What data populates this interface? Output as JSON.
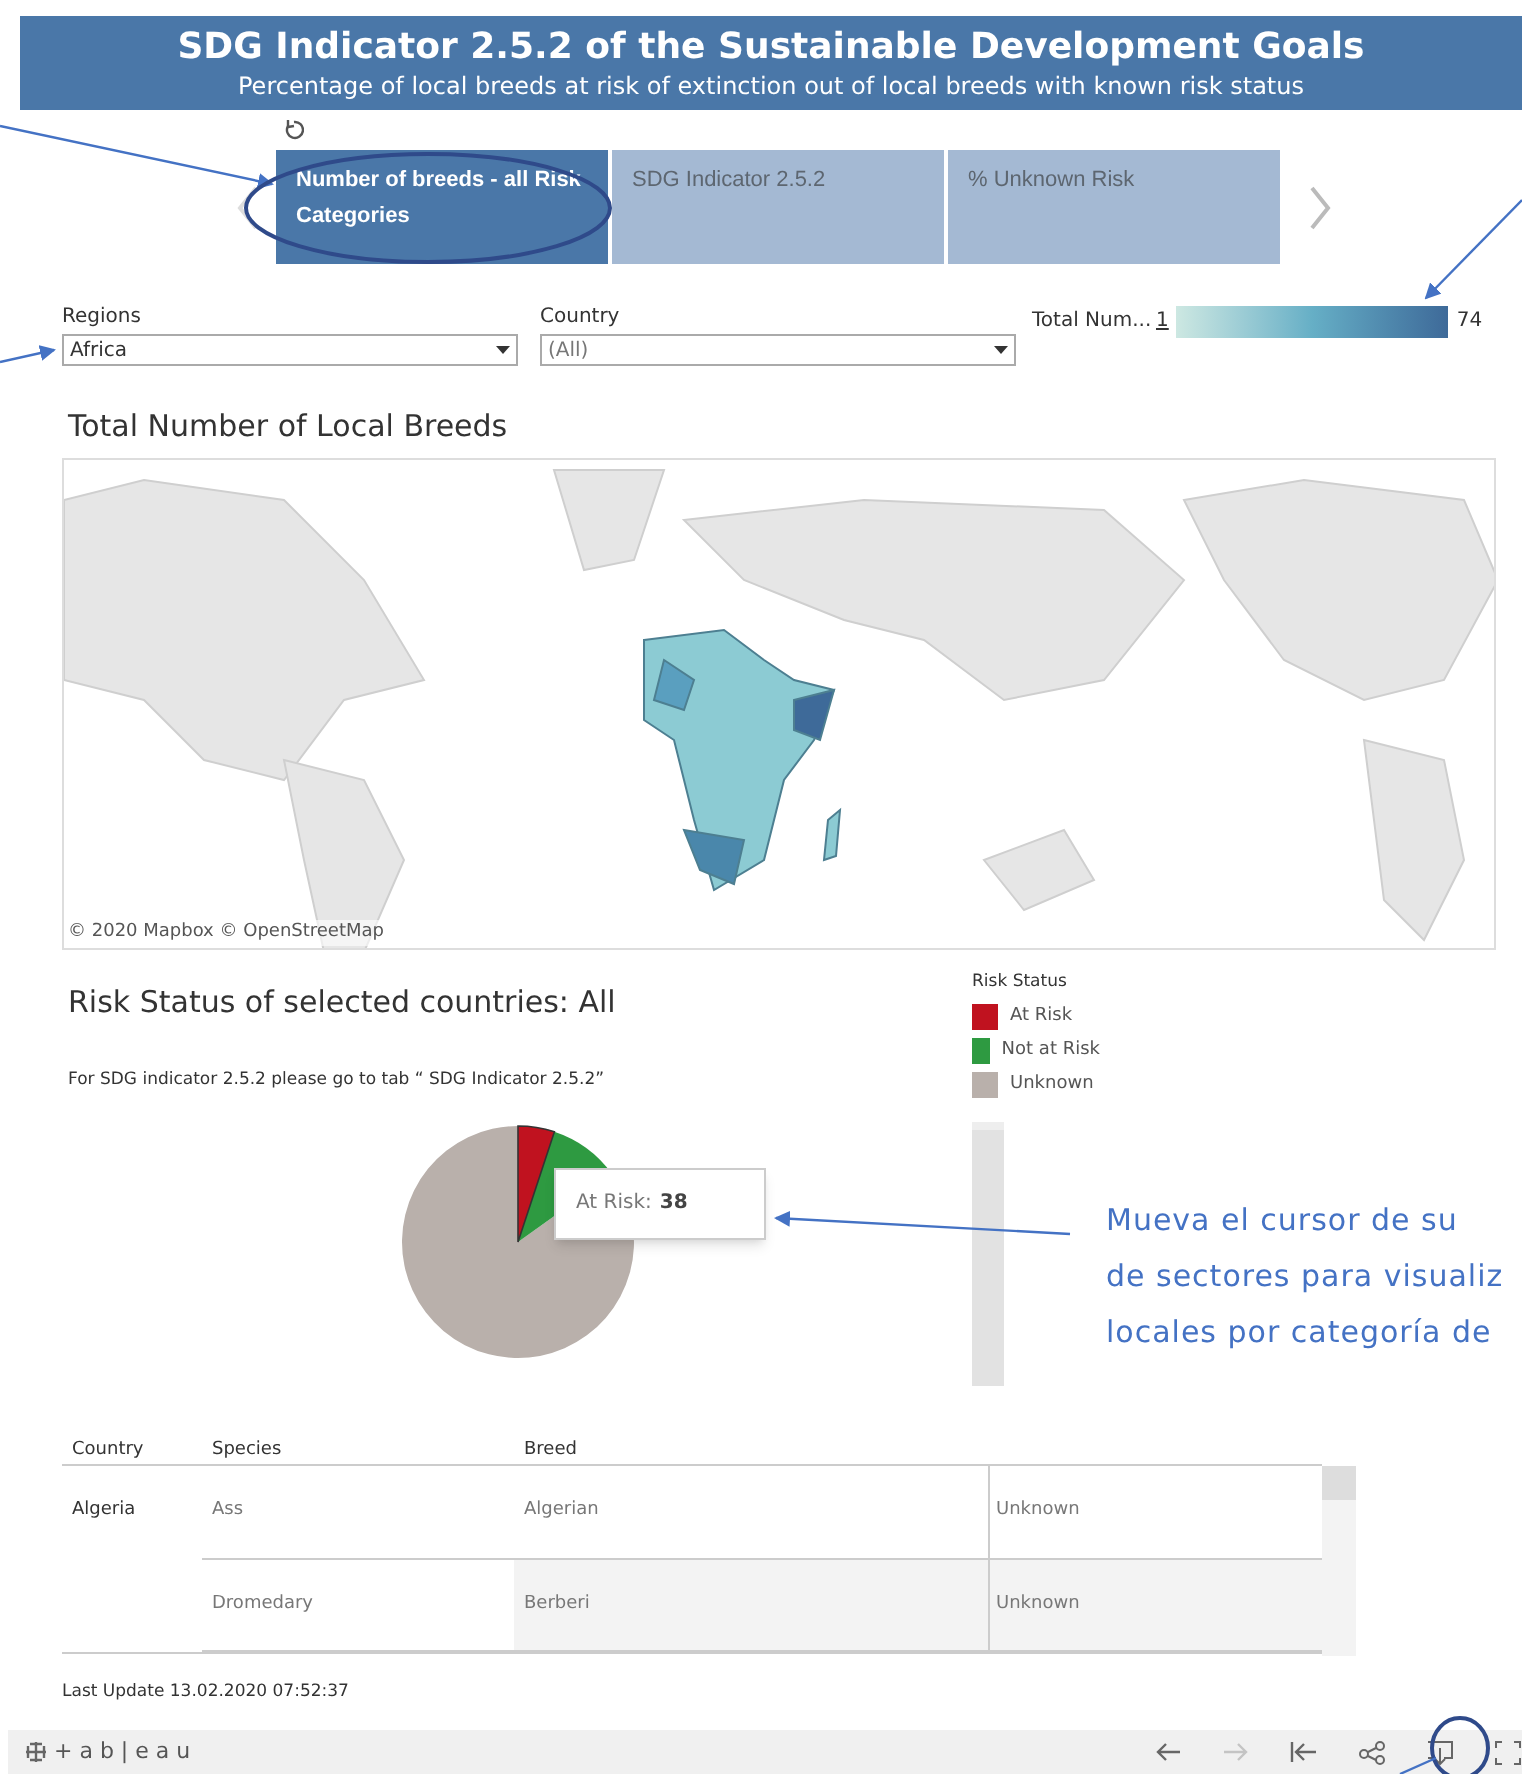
{
  "header": {
    "title": "SDG Indicator 2.5.2 of the Sustainable Development Goals",
    "subtitle": "Percentage of local breeds at risk of extinction out of local breeds with known risk status"
  },
  "tabs": [
    {
      "label": "Number of breeds - all Risk Categories",
      "selected": true
    },
    {
      "label": "SDG Indicator 2.5.2",
      "selected": false
    },
    {
      "label": "% Unknown Risk",
      "selected": false
    }
  ],
  "filters": [
    {
      "label": "Regions",
      "value": "Africa"
    },
    {
      "label": "Country",
      "value": "(All)"
    }
  ],
  "color_legend": {
    "label": "Total Num...",
    "min": "1",
    "max": "74"
  },
  "map": {
    "title": "Total Number of Local Breeds",
    "attribution": "© 2020 Mapbox © OpenStreetMap"
  },
  "risk": {
    "title": "Risk Status of selected countries: All",
    "note": "For SDG indicator 2.5.2 please go to tab  “ SDG Indicator 2.5.2”",
    "legend_title": "Risk Status",
    "legend": [
      {
        "label": "At Risk",
        "color": "#c0121f"
      },
      {
        "label": "Not at Risk",
        "color": "#2e9a41"
      },
      {
        "label": "Unknown",
        "color": "#b9b0ab"
      }
    ],
    "tooltip": {
      "label": "At Risk:",
      "value": "38"
    }
  },
  "callout_lines": [
    "Mueva el cursor de su",
    "de sectores para visualiz",
    "locales por categoría de"
  ],
  "table": {
    "columns": [
      "Country",
      "Species",
      "Breed"
    ],
    "rows": [
      {
        "country": "Algeria",
        "species": "Ass",
        "breed": "Algerian",
        "column_4": "Unknown"
      },
      {
        "species": "Dromedary",
        "breed": "Berberi",
        "column_4": "Unknown"
      }
    ]
  },
  "last_update": "Last Update 13.02.2020 07:52:37",
  "footer_logo": "+ a b | e a u",
  "toolbar": [
    {
      "kind": "back",
      "disabled": false
    },
    {
      "kind": "forward",
      "disabled": true
    },
    {
      "kind": "first",
      "disabled": false
    },
    {
      "kind": "share",
      "disabled": false
    },
    {
      "kind": "download",
      "disabled": false
    },
    {
      "kind": "fullscreen",
      "disabled": false
    }
  ]
}
